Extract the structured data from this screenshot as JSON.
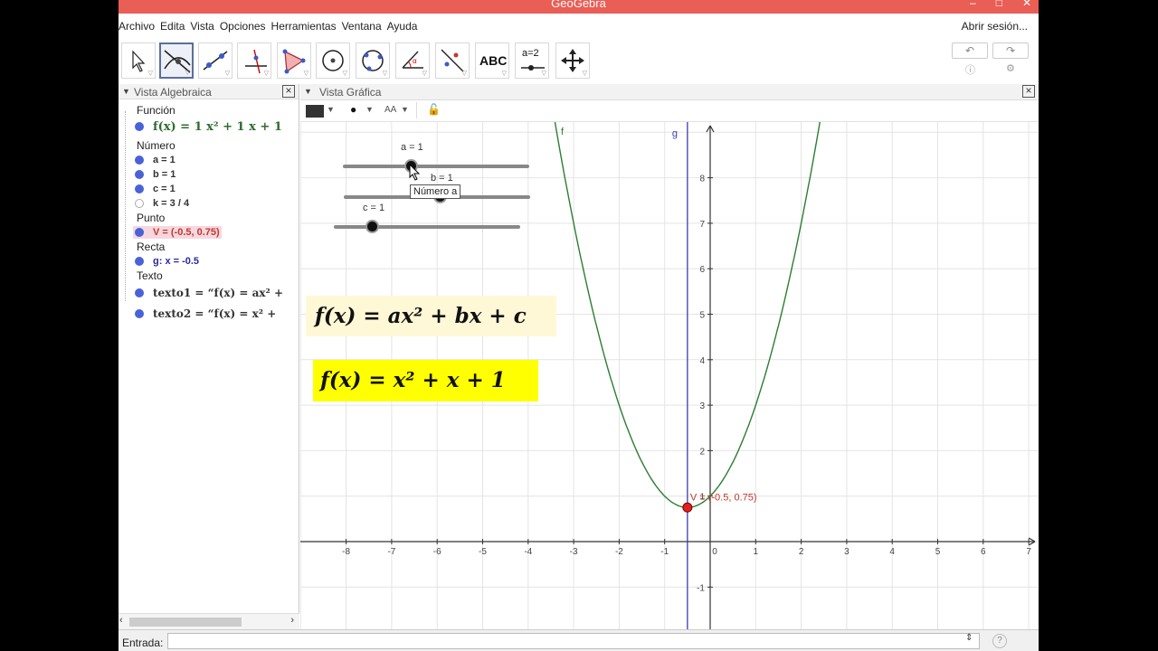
{
  "window": {
    "title": "GeoGebra"
  },
  "menu": [
    "Archivo",
    "Edita",
    "Vista",
    "Opciones",
    "Herramientas",
    "Ventana",
    "Ayuda"
  ],
  "signin": "Abrir sesión...",
  "algebra": {
    "title": "Vista Algebraica",
    "groups": {
      "funcion": "Función",
      "numero": "Número",
      "punto": "Punto",
      "recta": "Recta",
      "texto": "Texto"
    },
    "items": {
      "f": "f(x) = 1 x² + 1 x + 1",
      "a": "a = 1",
      "b": "b = 1",
      "c": "c = 1",
      "k": "k = 3 / 4",
      "V": "V = (-0.5, 0.75)",
      "g": "g: x = -0.5",
      "texto1": "texto1 = “f(x) = ax² +",
      "texto2": "texto2 = “f(x) = x²  +"
    }
  },
  "graphics": {
    "title": "Vista Gráfica",
    "font_size_label": "AA",
    "sliders": {
      "a": "a = 1",
      "b": "b = 1",
      "c": "c = 1"
    },
    "tooltip": "Número a",
    "formula_general": "f(x) = ax² + bx + c",
    "formula_specific": "f(x) = x² + x + 1",
    "func_label": "f",
    "line_label": "g",
    "point_label": "V = (-0.5, 0.75)",
    "x_ticks": [
      "-8",
      "-7",
      "-6",
      "-5",
      "-4",
      "-3",
      "-2",
      "-1",
      "0",
      "1",
      "2",
      "3",
      "4",
      "5",
      "6",
      "7"
    ],
    "y_ticks": [
      "8",
      "7",
      "6",
      "5",
      "4",
      "3",
      "2",
      "1",
      "-1"
    ]
  },
  "input": {
    "label": "Entrada:"
  },
  "toolbar": {
    "abc_label": "ABC",
    "slider_label": "a=2"
  },
  "colors": {
    "titlebar": "#e95e55",
    "curve": "#2e7d32",
    "line": "#3b3bb0",
    "point": "#d50000",
    "formula1_bg": "#fff8d6",
    "formula2_bg": "#ffff00"
  }
}
